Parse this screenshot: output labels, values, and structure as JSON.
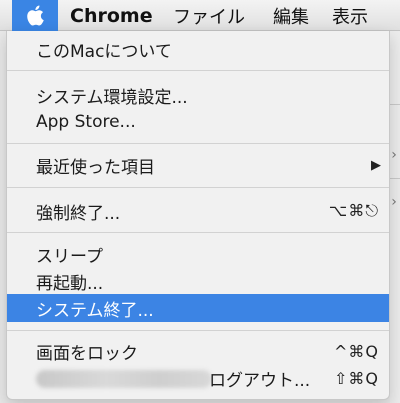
{
  "menubar": {
    "app_name": "Chrome",
    "items": [
      "ファイル",
      "編集",
      "表示"
    ]
  },
  "apple_menu": {
    "about": "このMacについて",
    "system_prefs": "システム環境設定...",
    "app_store": "App Store...",
    "recent_items": "最近使った項目",
    "force_quit": {
      "label": "強制終了...",
      "shortcut": "⌥⌘⎋"
    },
    "sleep": "スリープ",
    "restart": "再起動...",
    "shutdown": "システム終了...",
    "lock_screen": {
      "label": "画面をロック",
      "shortcut": "^⌘Q"
    },
    "logout": {
      "label": "ログアウト...",
      "shortcut": "⇧⌘Q"
    }
  },
  "colors": {
    "accent": "#3c84e4",
    "menu_bg": "#f1f1f1",
    "separator": "#d2d2d2"
  },
  "icons": [
    "apple-icon",
    "submenu-arrow-icon"
  ]
}
